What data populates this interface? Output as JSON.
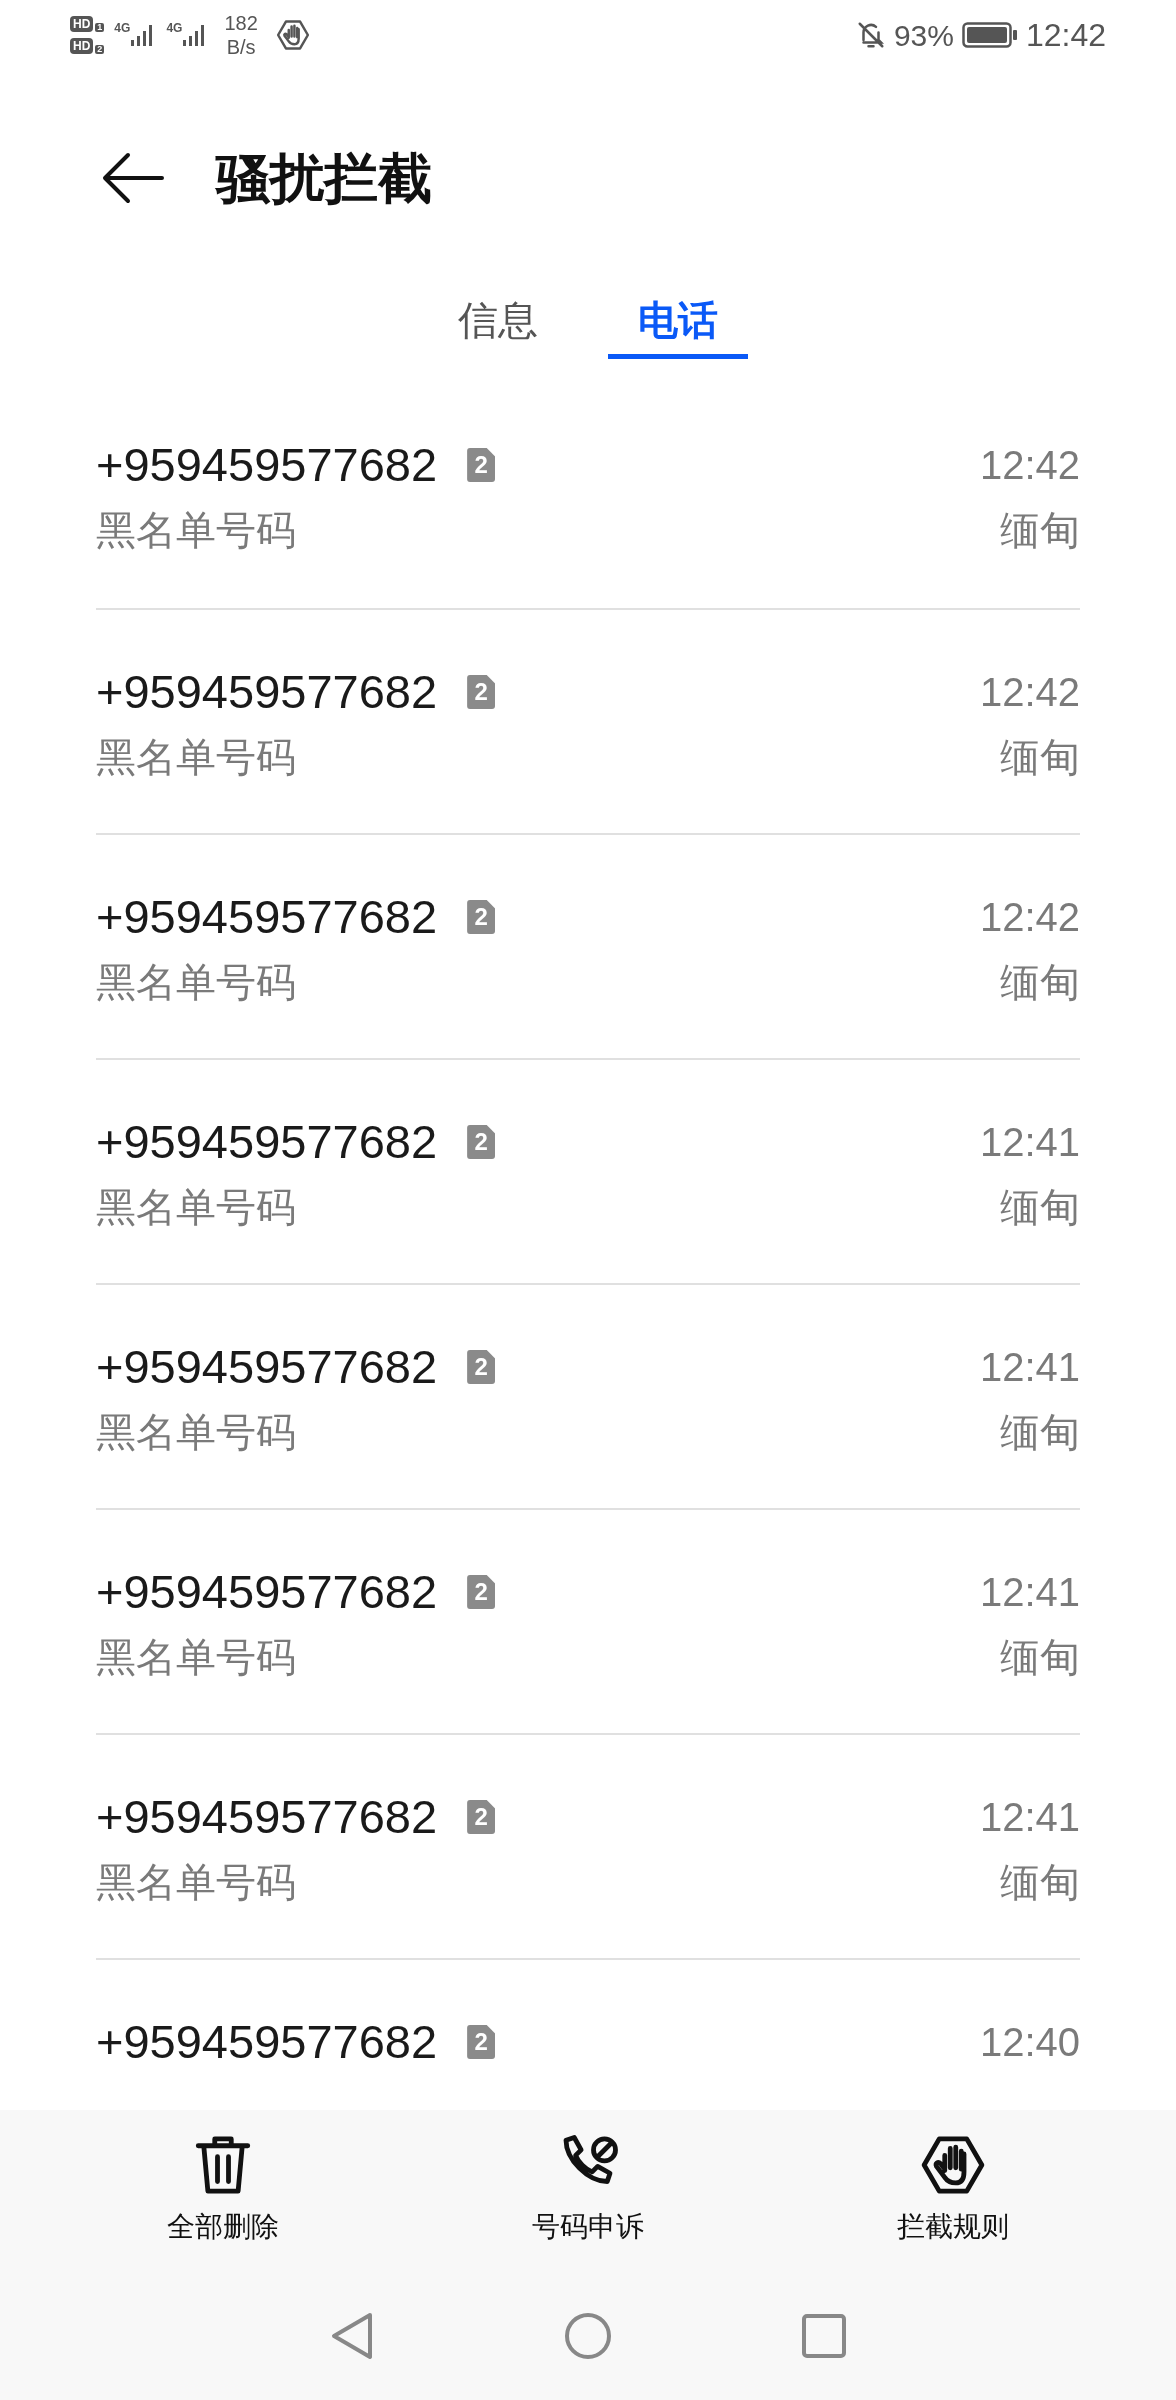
{
  "status_bar": {
    "sim_badges": [
      {
        "label": "HD",
        "slot": "1"
      },
      {
        "label": "HD",
        "slot": "2"
      }
    ],
    "signals": [
      {
        "network": "4G"
      },
      {
        "network": "4G"
      }
    ],
    "speed": {
      "value": "182",
      "unit": "B/s"
    },
    "battery": "93%",
    "time": "12:42"
  },
  "header": {
    "title": "骚扰拦截"
  },
  "tabs": [
    {
      "label": "信息",
      "selected": false
    },
    {
      "label": "电话",
      "selected": true
    }
  ],
  "calls": [
    {
      "number": "+959459577682",
      "sim": "2",
      "time": "12:42",
      "tag": "黑名单号码",
      "location": "缅甸"
    },
    {
      "number": "+959459577682",
      "sim": "2",
      "time": "12:42",
      "tag": "黑名单号码",
      "location": "缅甸"
    },
    {
      "number": "+959459577682",
      "sim": "2",
      "time": "12:42",
      "tag": "黑名单号码",
      "location": "缅甸"
    },
    {
      "number": "+959459577682",
      "sim": "2",
      "time": "12:41",
      "tag": "黑名单号码",
      "location": "缅甸"
    },
    {
      "number": "+959459577682",
      "sim": "2",
      "time": "12:41",
      "tag": "黑名单号码",
      "location": "缅甸"
    },
    {
      "number": "+959459577682",
      "sim": "2",
      "time": "12:41",
      "tag": "黑名单号码",
      "location": "缅甸"
    },
    {
      "number": "+959459577682",
      "sim": "2",
      "time": "12:41",
      "tag": "黑名单号码",
      "location": "缅甸"
    },
    {
      "number": "+959459577682",
      "sim": "2",
      "time": "12:40"
    }
  ],
  "actions": [
    {
      "label": "全部删除",
      "kind": "delete"
    },
    {
      "label": "号码申诉",
      "kind": "appeal"
    },
    {
      "label": "拦截规则",
      "kind": "rules"
    }
  ]
}
